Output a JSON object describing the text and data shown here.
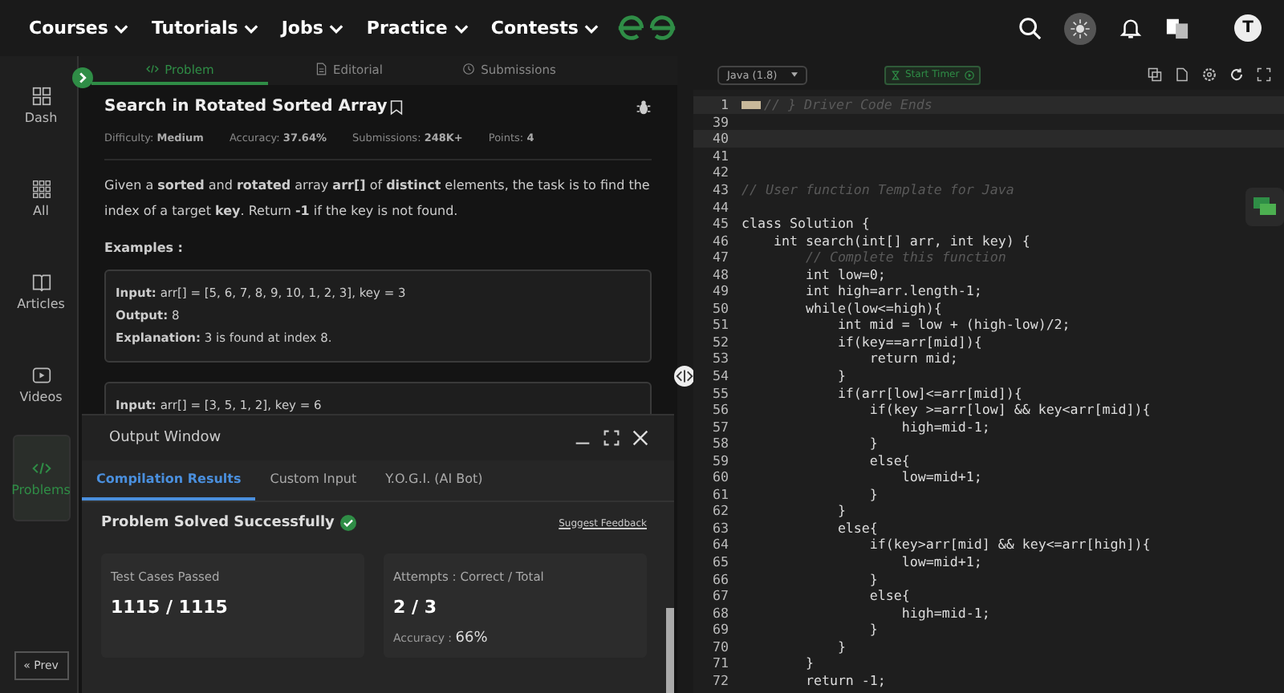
{
  "nav": {
    "menus": [
      {
        "label": "Courses"
      },
      {
        "label": "Tutorials"
      },
      {
        "label": "Jobs"
      },
      {
        "label": "Practice"
      },
      {
        "label": "Contests"
      }
    ],
    "avatar": "T"
  },
  "sidebar": {
    "items": [
      {
        "label": "Dash",
        "kind": "dash",
        "selected": false
      },
      {
        "label": "All",
        "kind": "all",
        "selected": false
      },
      {
        "label": "Articles",
        "kind": "articles",
        "selected": false
      },
      {
        "label": "Videos",
        "kind": "videos",
        "selected": false
      },
      {
        "label": "Problems",
        "kind": "problems",
        "selected": true
      }
    ],
    "prev": "« Prev"
  },
  "problem_tabs": [
    {
      "label": "Problem",
      "kind": "problem",
      "selected": true
    },
    {
      "label": "Editorial",
      "kind": "editorial",
      "selected": false
    },
    {
      "label": "Submissions",
      "kind": "submissions",
      "selected": false
    }
  ],
  "problem": {
    "title": "Search in Rotated Sorted Array",
    "meta": [
      {
        "label": "Difficulty:",
        "value": "Medium"
      },
      {
        "label": "Accuracy:",
        "value": "37.64%"
      },
      {
        "label": "Submissions:",
        "value": "248K+"
      },
      {
        "label": "Points:",
        "value": "4"
      }
    ],
    "statement": "Given a **sorted** and **rotated** array **arr[]** of **distinct** elements, the task is to find the index of a target **key**. Return **-1** if the key is not found.",
    "examples_heading": "Examples :",
    "examples": [
      {
        "lines": [
          "**Input:** arr[] = [5, 6, 7, 8, 9, 10, 1, 2, 3], key = 3",
          "**Output:** 8",
          "**Explanation:** 3 is found at index 8."
        ]
      },
      {
        "lines": [
          "**Input:** arr[] = [3, 5, 1, 2], key = 6"
        ]
      }
    ]
  },
  "output_window": {
    "title": "Output Window",
    "tabs": [
      {
        "label": "Compilation Results",
        "selected": true
      },
      {
        "label": "Custom Input",
        "selected": false
      },
      {
        "label": "Y.O.G.I. (AI Bot)",
        "selected": false
      }
    ],
    "status": "Problem Solved Successfully",
    "feedback": "Suggest Feedback",
    "cards": [
      {
        "label": "Test Cases Passed",
        "value": "1115 / 1115"
      },
      {
        "label": "Attempts : Correct / Total",
        "value": "2 / 3",
        "extra_label": "Accuracy :",
        "extra_value": "66%"
      }
    ]
  },
  "editor": {
    "language": "Java (1.8)",
    "timer": "Start Timer",
    "lines": [
      {
        "number": "1",
        "text": "// } Driver Code Ends",
        "kind": "folded"
      },
      {
        "number": "39",
        "kind": "blank"
      },
      {
        "number": "40",
        "kind": "active"
      },
      {
        "number": "41",
        "kind": "blank"
      },
      {
        "number": "42",
        "kind": "blank"
      },
      {
        "number": "43",
        "text": "// User function Template for Java",
        "kind": "comment"
      },
      {
        "number": "44",
        "kind": "blank"
      },
      {
        "number": "45",
        "text": "class Solution {",
        "kind": "code"
      },
      {
        "number": "46",
        "text": "    int search(int[] arr, int key) {",
        "kind": "code"
      },
      {
        "number": "47",
        "text": "        // Complete this function",
        "kind": "comment"
      },
      {
        "number": "48",
        "text": "        int low=0;",
        "kind": "code"
      },
      {
        "number": "49",
        "text": "        int high=arr.length-1;",
        "kind": "code"
      },
      {
        "number": "50",
        "text": "        while(low<=high){",
        "kind": "code"
      },
      {
        "number": "51",
        "text": "            int mid = low + (high-low)/2;",
        "kind": "code"
      },
      {
        "number": "52",
        "text": "            if(key==arr[mid]){",
        "kind": "code"
      },
      {
        "number": "53",
        "text": "                return mid;",
        "kind": "code"
      },
      {
        "number": "54",
        "text": "            }",
        "kind": "code"
      },
      {
        "number": "55",
        "text": "            if(arr[low]<=arr[mid]){",
        "kind": "code"
      },
      {
        "number": "56",
        "text": "                if(key >=arr[low] && key<arr[mid]){",
        "kind": "code"
      },
      {
        "number": "57",
        "text": "                    high=mid-1;",
        "kind": "code"
      },
      {
        "number": "58",
        "text": "                }",
        "kind": "code"
      },
      {
        "number": "59",
        "text": "                else{",
        "kind": "code"
      },
      {
        "number": "60",
        "text": "                    low=mid+1;",
        "kind": "code"
      },
      {
        "number": "61",
        "text": "                }",
        "kind": "code"
      },
      {
        "number": "62",
        "text": "            }",
        "kind": "code"
      },
      {
        "number": "63",
        "text": "            else{",
        "kind": "code"
      },
      {
        "number": "64",
        "text": "                if(key>arr[mid] && key<=arr[high]){",
        "kind": "code"
      },
      {
        "number": "65",
        "text": "                    low=mid+1;",
        "kind": "code"
      },
      {
        "number": "66",
        "text": "                }",
        "kind": "code"
      },
      {
        "number": "67",
        "text": "                else{",
        "kind": "code"
      },
      {
        "number": "68",
        "text": "                    high=mid-1;",
        "kind": "code"
      },
      {
        "number": "69",
        "text": "                }",
        "kind": "code"
      },
      {
        "number": "70",
        "text": "            }",
        "kind": "code"
      },
      {
        "number": "71",
        "text": "        }",
        "kind": "code"
      },
      {
        "number": "72",
        "text": "        return -1;",
        "kind": "code"
      }
    ]
  }
}
